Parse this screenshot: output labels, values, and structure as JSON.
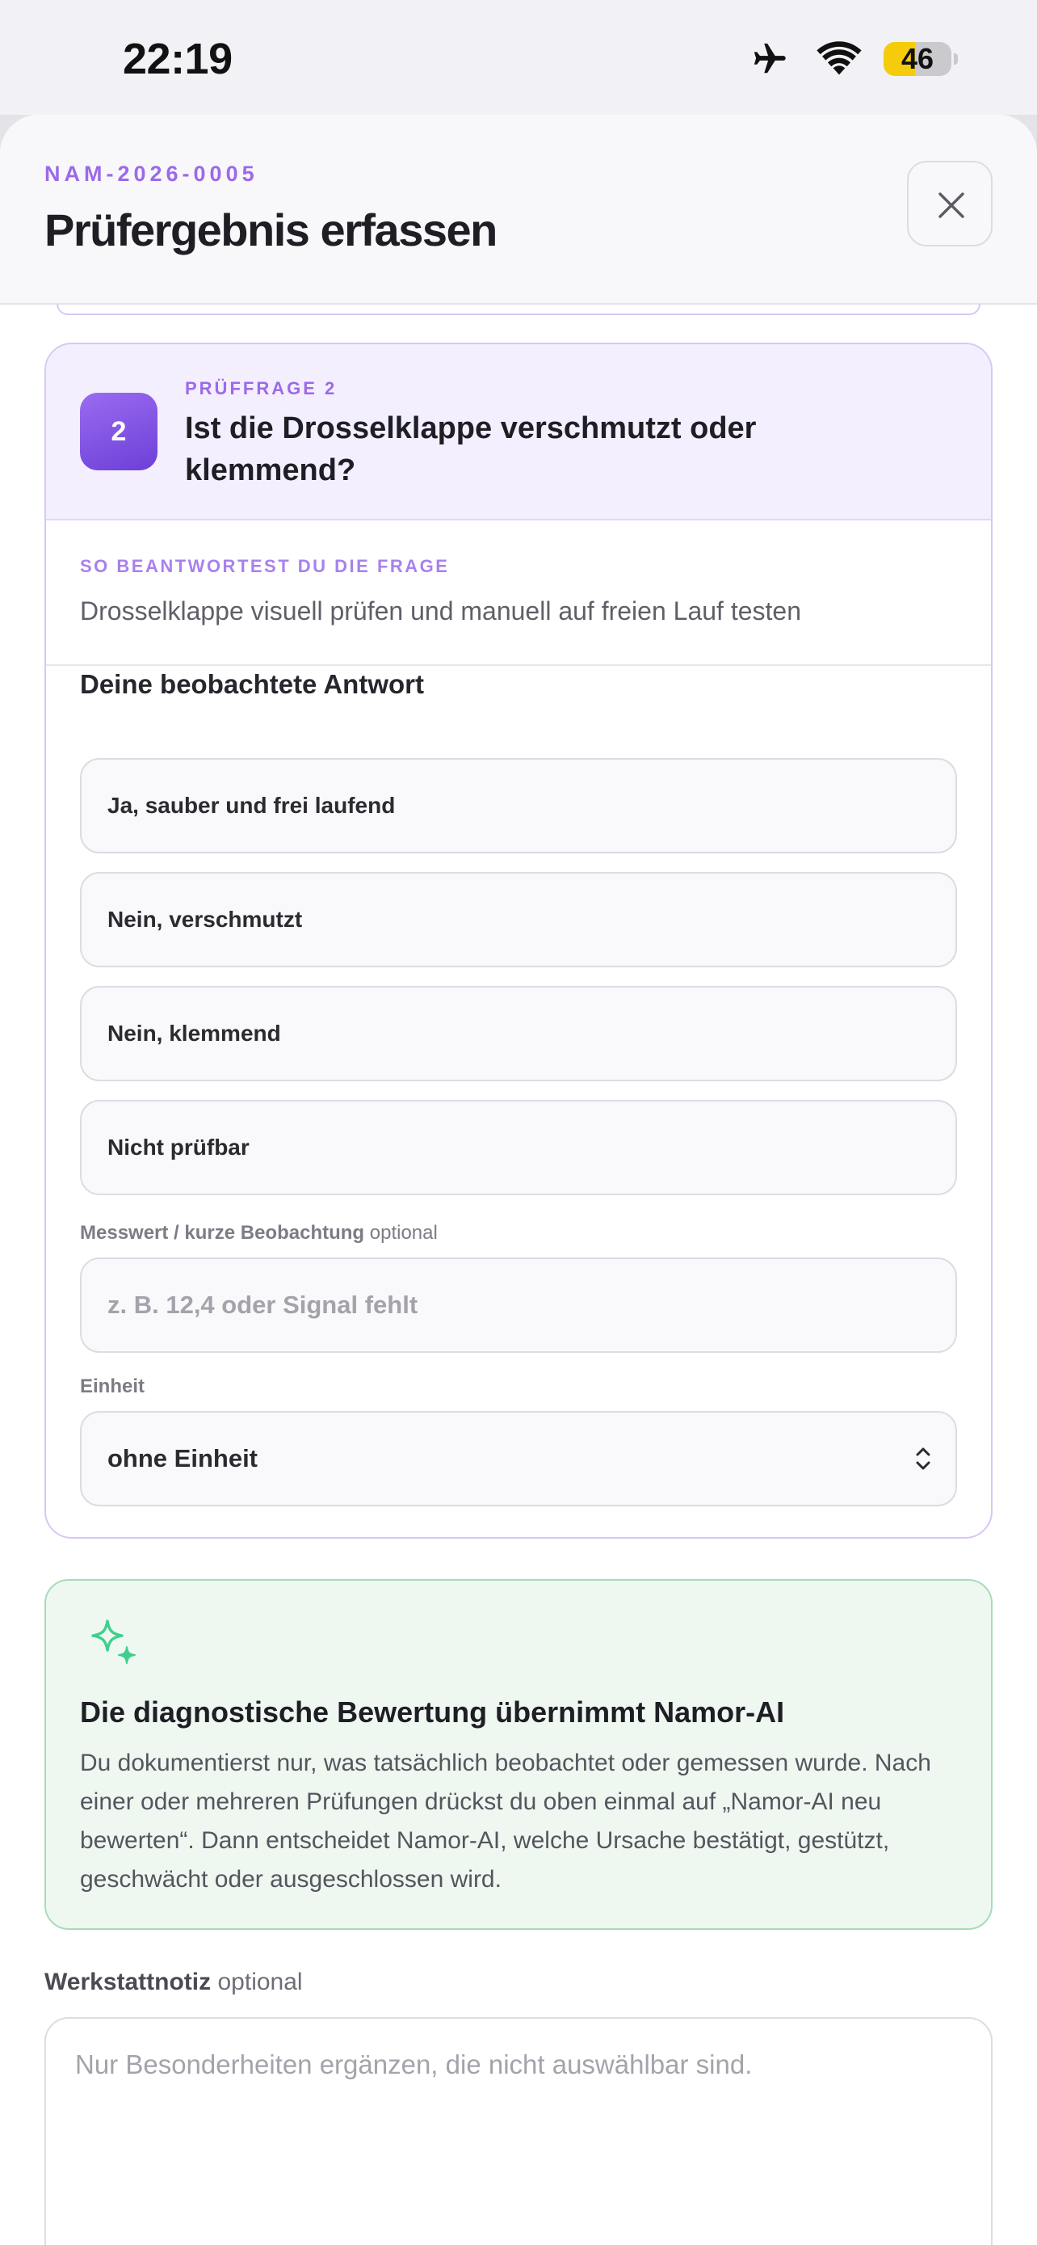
{
  "status_bar": {
    "time": "22:19",
    "battery_level": "46",
    "battery_fraction": 0.46,
    "icons": [
      "airplane-icon",
      "wifi-icon",
      "battery-icon"
    ]
  },
  "header": {
    "ref_code": "NAM-2026-0005",
    "title": "Prüfergebnis erfassen",
    "close_icon": "close-icon"
  },
  "question": {
    "number": "2",
    "label": "PRÜFFRAGE 2",
    "title": "Ist die Drosselklappe verschmutzt oder klemmend?",
    "hint_label": "SO BEANTWORTEST DU DIE FRAGE",
    "hint_text": "Drosselklappe visuell prüfen und manuell auf freien Lauf testen",
    "answer_heading": "Deine beobachtete Antwort",
    "options": [
      "Ja, sauber und frei laufend",
      "Nein, verschmutzt",
      "Nein, klemmend",
      "Nicht prüfbar"
    ],
    "measurement_label": "Messwert / kurze Beobachtung",
    "measurement_optional": "optional",
    "measurement_placeholder": "z. B. 12,4 oder Signal fehlt",
    "unit_label": "Einheit",
    "unit_value": "ohne Einheit"
  },
  "ai_info": {
    "icon": "sparkle-icon",
    "title": "Die diagnostische Bewertung übernimmt Namor-AI",
    "text": "Du dokumentierst nur, was tatsächlich beobachtet oder gemessen wurde. Nach einer oder mehreren Prüfungen drückst du oben einmal auf „Namor-AI neu bewerten“. Dann entscheidet Namor-AI, welche Ursache bestätigt, gestützt, geschwächt oder ausgeschlossen wird."
  },
  "workshop_note": {
    "label": "Werkstattnotiz",
    "optional": "optional",
    "placeholder": "Nur Besonderheiten ergänzen, die nicht auswählbar sind."
  },
  "colors": {
    "accent": "#9b6ae8",
    "badge": "#7c4ddf",
    "success_bg": "#eef8f1",
    "success_border": "#a8dcb8",
    "sparkle": "#3ecf8e",
    "battery": "#f6cb0b"
  }
}
